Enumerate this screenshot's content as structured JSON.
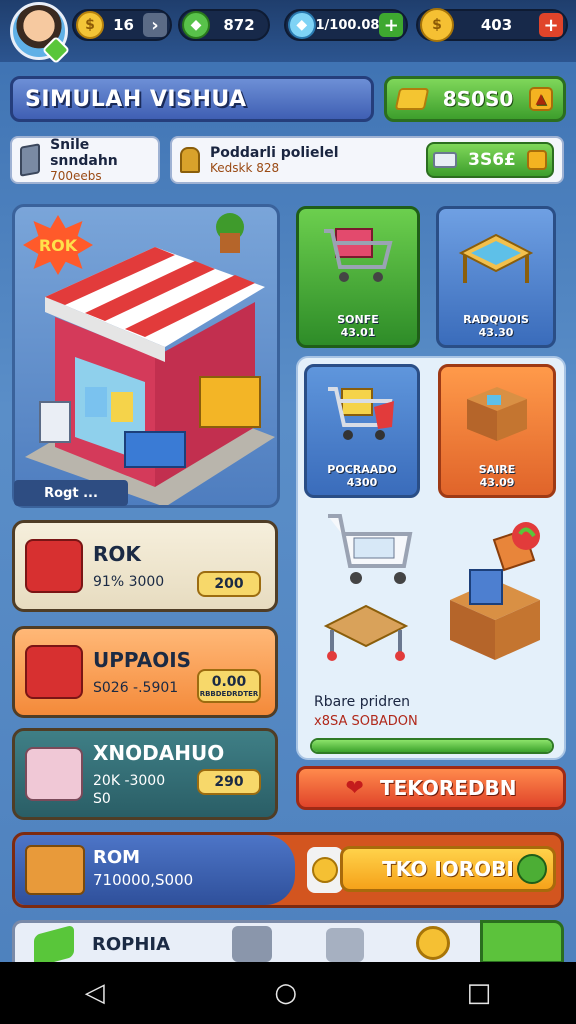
{
  "topbar": {
    "coins": "16",
    "gems": "872",
    "diamonds": "1/100.08",
    "gold": "403",
    "plus": "+"
  },
  "title": "SIMULAH VISHUA",
  "cash_button": {
    "value": "8S0S0",
    "arrow": "▲"
  },
  "info": {
    "left_title": "Snile snndahn",
    "left_sub": "700eebs",
    "right_title": "Poddarli polielel",
    "right_sub": "Kedskk 828",
    "mini_value": "3S6£"
  },
  "scene": {
    "badge": "ROK",
    "label": "Rogt ..."
  },
  "shop_items": [
    {
      "name": "SONFE",
      "price": "43.01"
    },
    {
      "name": "RADQUOIS",
      "price": "43.30"
    },
    {
      "name": "POCRAADO",
      "price": "4300"
    },
    {
      "name": "SAIRE",
      "price": "43.09"
    }
  ],
  "shop": {
    "caption": "Rbare pridren",
    "sub": "x8SA SOBADON",
    "progress": 1.0,
    "button_label": "TEKOREDBN"
  },
  "stat_cards": [
    {
      "title": "ROK",
      "sub": "91% 3000",
      "price": "200"
    },
    {
      "title": "UPPAOIS",
      "sub": "S026 -.5901",
      "price": "0.00",
      "price_sub": "RBBDEDRDTER"
    },
    {
      "title": "XNODAHUO",
      "sub": "20K -3000",
      "sub2": "S0",
      "price": "290"
    }
  ],
  "banner": {
    "title": "ROM",
    "sub": "710000,S000",
    "button_label": "TKO IOROBI"
  },
  "bottom": {
    "label": "ROPHIA"
  },
  "navbar": {
    "back": "◁",
    "home": "○",
    "recents": "□"
  },
  "colors": {
    "accent_green": "#3d9e2c",
    "accent_blue": "#3f5fb3",
    "accent_red": "#e0442a",
    "accent_gold": "#f5a21a"
  }
}
